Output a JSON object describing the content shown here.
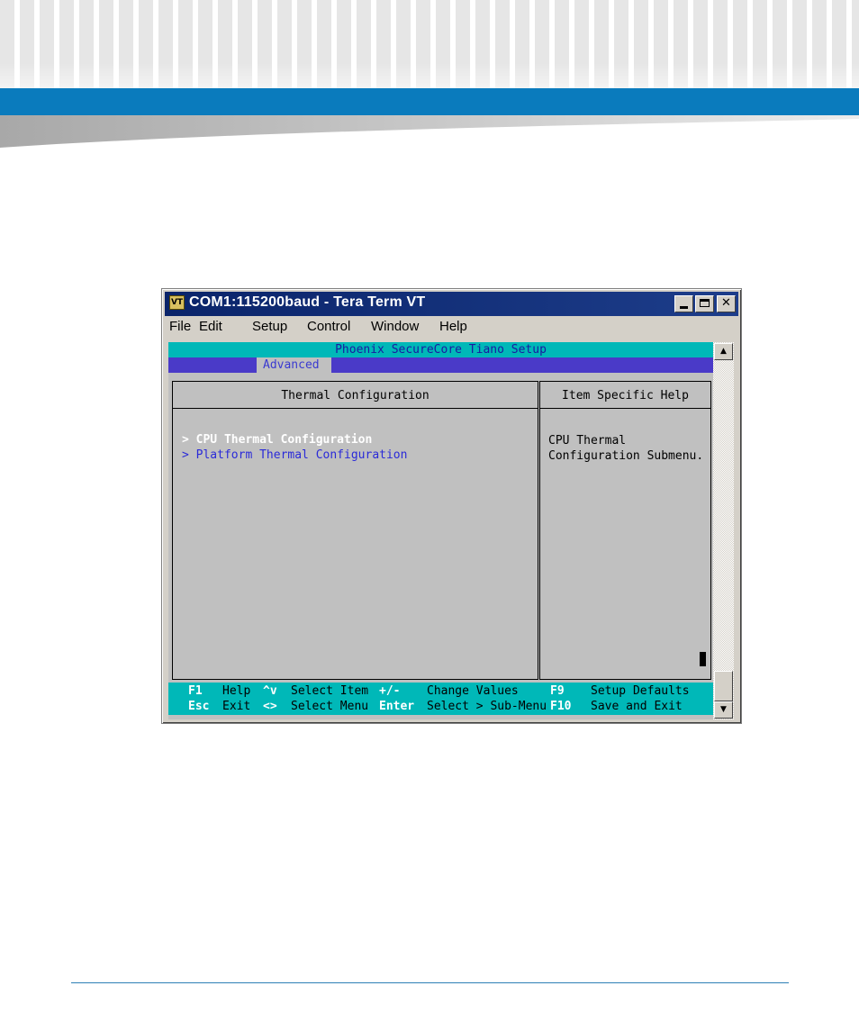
{
  "window": {
    "title": "COM1:115200baud - Tera Term VT",
    "icon_label": "VT"
  },
  "menubar": {
    "items": [
      "File",
      "Edit",
      "Setup",
      "Control",
      "Window",
      "Help"
    ]
  },
  "bios": {
    "header": "Phoenix SecureCore Tiano Setup",
    "active_tab": "Advanced",
    "panel_title": "Thermal Configuration",
    "help_title": "Item Specific Help",
    "menu_items": [
      "> CPU Thermal Configuration",
      "> Platform Thermal Configuration"
    ],
    "help_lines": [
      "CPU Thermal",
      "Configuration Submenu."
    ],
    "footer": {
      "row1": [
        {
          "key": "F1",
          "desc": "Help"
        },
        {
          "key": "^v",
          "desc": "Select Item"
        },
        {
          "key": "+/-",
          "desc": "Change Values"
        },
        {
          "key": "F9",
          "desc": "Setup Defaults"
        }
      ],
      "row2": [
        {
          "key": "Esc",
          "desc": "Exit"
        },
        {
          "key": "<>",
          "desc": "Select Menu"
        },
        {
          "key": "Enter",
          "desc": "Select > Sub-Menu"
        },
        {
          "key": "F10",
          "desc": "Save and Exit"
        }
      ]
    }
  },
  "colors": {
    "page_band": "#0a7bbd",
    "footer_rule": "#2e7fb6",
    "bios_cyan": "#00b8b8",
    "bios_blue": "#4a3ac8",
    "selected_item": "#ffffff",
    "unselected_item": "#2a2ad8"
  }
}
